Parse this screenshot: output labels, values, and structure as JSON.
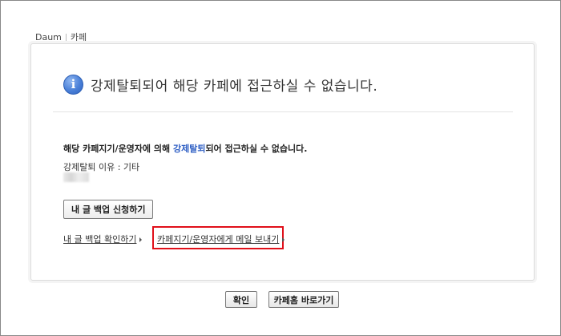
{
  "breadcrumb": {
    "brand": "Daum",
    "section": "카페"
  },
  "heading": {
    "icon": "info-icon",
    "text": "강제탈퇴되어 해당 카페에 접근하실 수 없습니다."
  },
  "notice": {
    "prefix": "해당 카페지기/운영자에 의해 ",
    "highlight": "강제탈퇴",
    "suffix": "되어 접근하실 수 없습니다."
  },
  "reason": {
    "label": "강제탈퇴 이유 : 기타"
  },
  "backup_button": {
    "label": "내 글 백업 신청하기"
  },
  "links": {
    "backup_check": "내 글 백업 확인하기",
    "mail_manager": "카페지기/운영자에게 메일 보내기"
  },
  "footer": {
    "ok_label": "확인",
    "home_label": "카페홈 바로가기"
  },
  "colors": {
    "highlight": "#2f5fc4",
    "annotation_box": "#e0101a"
  }
}
